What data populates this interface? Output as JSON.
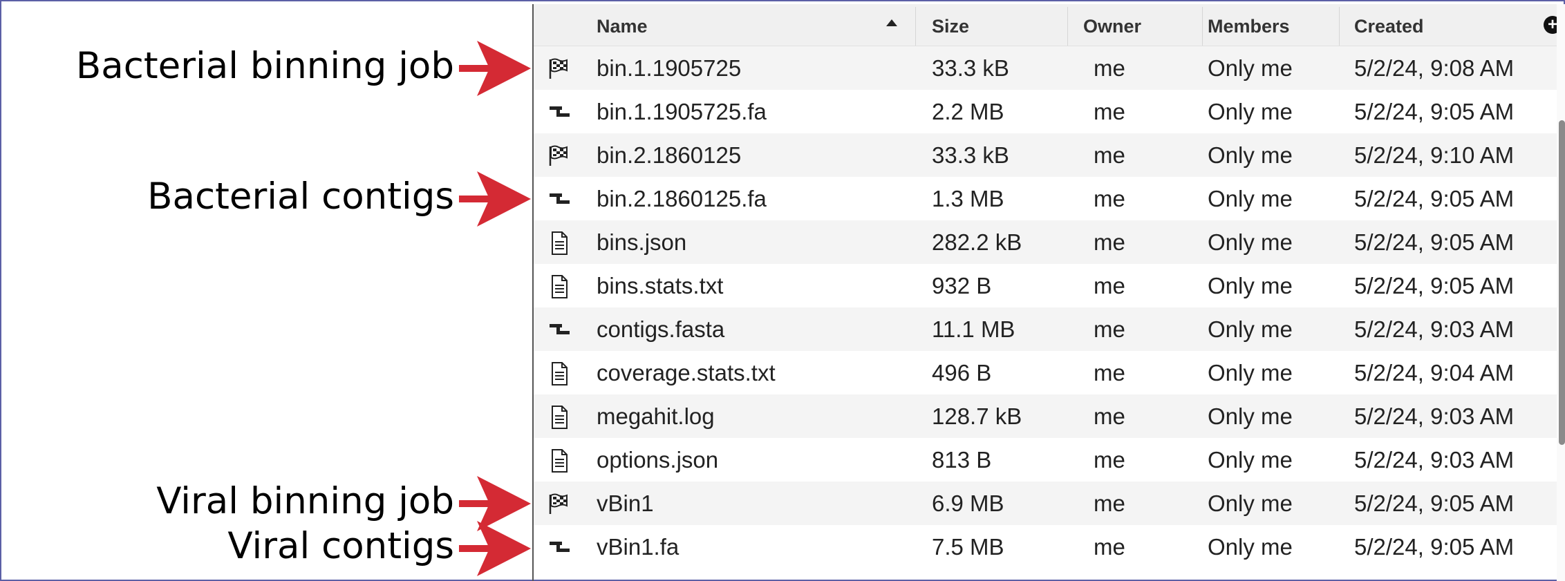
{
  "annotations": [
    {
      "label": "Bacterial binning job",
      "row": 0
    },
    {
      "label": "Bacterial contigs",
      "row": 3
    },
    {
      "label": "Viral binning job",
      "row": 10
    },
    {
      "label": "Viral contigs",
      "row": 11
    }
  ],
  "colors": {
    "arrow": "#d42a34",
    "header_bg": "#f0f0f0",
    "row_alt": "#f4f4f4",
    "frame": "#5b5fa6"
  },
  "table": {
    "columns": {
      "name": "Name",
      "size": "Size",
      "owner": "Owner",
      "members": "Members",
      "created": "Created"
    },
    "sort": {
      "column": "name",
      "direction": "ascending"
    },
    "rows": [
      {
        "icon": "job-flag-icon",
        "name": "bin.1.1905725",
        "size": "33.3 kB",
        "owner": "me",
        "members": "Only me",
        "created": "5/2/24, 9:08 AM"
      },
      {
        "icon": "contigs-icon",
        "name": "bin.1.1905725.fa",
        "size": "2.2 MB",
        "owner": "me",
        "members": "Only me",
        "created": "5/2/24, 9:05 AM"
      },
      {
        "icon": "job-flag-icon",
        "name": "bin.2.1860125",
        "size": "33.3 kB",
        "owner": "me",
        "members": "Only me",
        "created": "5/2/24, 9:10 AM"
      },
      {
        "icon": "contigs-icon",
        "name": "bin.2.1860125.fa",
        "size": "1.3 MB",
        "owner": "me",
        "members": "Only me",
        "created": "5/2/24, 9:05 AM"
      },
      {
        "icon": "document-icon",
        "name": "bins.json",
        "size": "282.2 kB",
        "owner": "me",
        "members": "Only me",
        "created": "5/2/24, 9:05 AM"
      },
      {
        "icon": "document-icon",
        "name": "bins.stats.txt",
        "size": "932 B",
        "owner": "me",
        "members": "Only me",
        "created": "5/2/24, 9:05 AM"
      },
      {
        "icon": "contigs-icon",
        "name": "contigs.fasta",
        "size": "11.1 MB",
        "owner": "me",
        "members": "Only me",
        "created": "5/2/24, 9:03 AM"
      },
      {
        "icon": "document-icon",
        "name": "coverage.stats.txt",
        "size": "496 B",
        "owner": "me",
        "members": "Only me",
        "created": "5/2/24, 9:04 AM"
      },
      {
        "icon": "document-icon",
        "name": "megahit.log",
        "size": "128.7 kB",
        "owner": "me",
        "members": "Only me",
        "created": "5/2/24, 9:03 AM"
      },
      {
        "icon": "document-icon",
        "name": "options.json",
        "size": "813 B",
        "owner": "me",
        "members": "Only me",
        "created": "5/2/24, 9:03 AM"
      },
      {
        "icon": "job-flag-icon",
        "name": "vBin1",
        "size": "6.9 MB",
        "owner": "me",
        "members": "Only me",
        "created": "5/2/24, 9:05 AM"
      },
      {
        "icon": "contigs-icon",
        "name": "vBin1.fa",
        "size": "7.5 MB",
        "owner": "me",
        "members": "Only me",
        "created": "5/2/24, 9:05 AM"
      }
    ]
  }
}
